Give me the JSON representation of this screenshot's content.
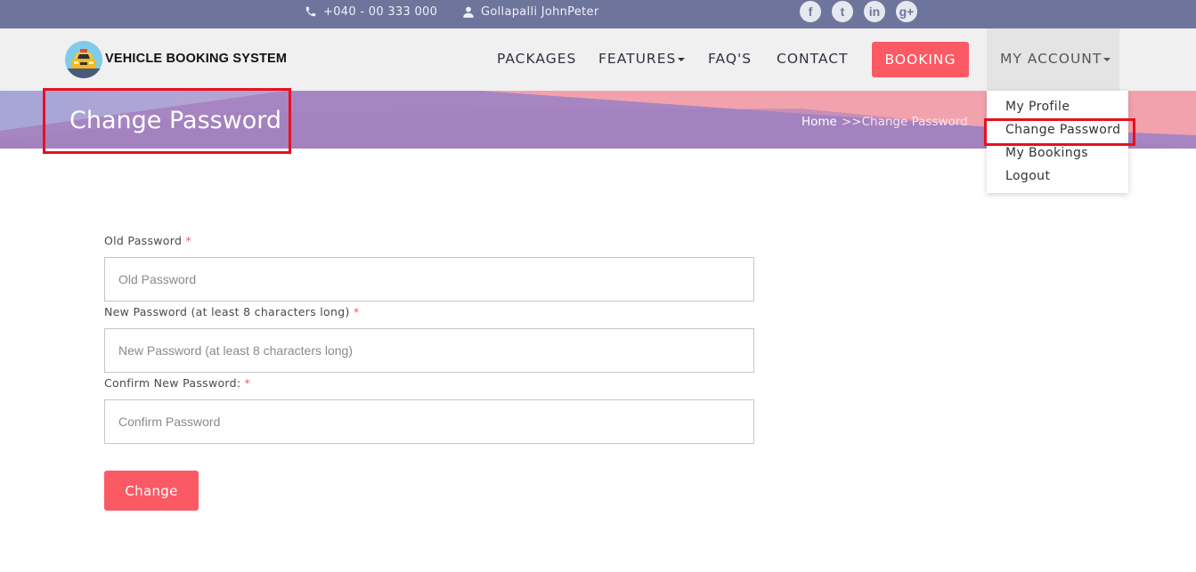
{
  "topbar": {
    "phone": "+040 - 00 333 000",
    "user": "Gollapalli JohnPeter",
    "social": [
      "f",
      "t",
      "in",
      "g+"
    ]
  },
  "brand": {
    "name": "VEHICLE BOOKING SYSTEM"
  },
  "nav": {
    "items": [
      {
        "label": "PACKAGES"
      },
      {
        "label": "FEATURES"
      },
      {
        "label": "FAQ'S"
      },
      {
        "label": "CONTACT"
      }
    ],
    "booking": "BOOKING",
    "account": "MY ACCOUNT"
  },
  "dropdown": {
    "items": [
      "My Profile",
      "Change Password",
      "My Bookings",
      "Logout"
    ]
  },
  "banner": {
    "title": "Change Password",
    "breadcrumb_home": "Home",
    "breadcrumb_current": ">>Change Password"
  },
  "form": {
    "required_mark": "*",
    "fields": [
      {
        "label": "Old Password",
        "placeholder": "Old Password",
        "value": ""
      },
      {
        "label": "New Password (at least 8 characters long)",
        "placeholder": "New Password (at least 8 characters long)",
        "value": ""
      },
      {
        "label": "Confirm New Password:",
        "placeholder": "Confirm Password",
        "value": ""
      }
    ],
    "submit": "Change"
  },
  "colors": {
    "topbar": "#6e759c",
    "navbar": "#f0f0f0",
    "accent": "#fb5a64",
    "highlight_box": "#e8101f"
  },
  "icons": [
    "phone-icon",
    "user-icon",
    "facebook-icon",
    "twitter-icon",
    "linkedin-icon",
    "google-plus-icon",
    "car-logo-icon",
    "caret-down-icon"
  ]
}
